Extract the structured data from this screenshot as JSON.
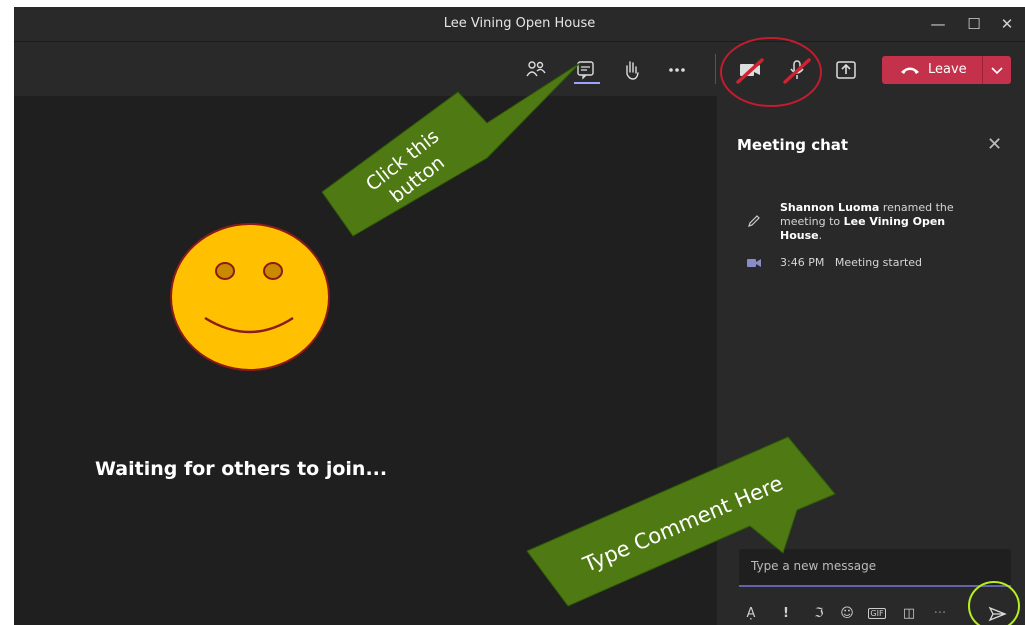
{
  "window": {
    "title": "Lee Vining Open House",
    "minimize_icon": "minimize-icon",
    "maximize_icon": "maximize-icon",
    "close_icon": "close-icon"
  },
  "toolbar": {
    "participants_icon": "people-icon",
    "chat_icon": "chat-icon",
    "raise_hand_icon": "hand-icon",
    "more_icon": "more-icon",
    "camera_icon": "camera-off-icon",
    "mic_icon": "mic-off-icon",
    "share_icon": "share-screen-icon",
    "leave_label": "Leave",
    "leave_color": "#c4314b"
  },
  "stage": {
    "waiting_text": "Waiting for others to join..."
  },
  "chat": {
    "title": "Meeting chat",
    "events": [
      {
        "icon": "pencil-icon",
        "actor": "Shannon Luoma",
        "text1": " renamed the meeting to ",
        "target": "Lee Vining Open House",
        "text2": "."
      },
      {
        "icon": "video-icon",
        "time": "3:46 PM",
        "text": "Meeting started"
      }
    ],
    "compose_placeholder": "Type a new message",
    "compose_tools": [
      "format-icon",
      "important-icon",
      "attach-icon",
      "emoji-icon",
      "gif-icon",
      "sticker-icon",
      "more-icon"
    ],
    "send_icon": "send-icon",
    "accent": "#6264a7"
  },
  "annotations": {
    "click_callout": "Click this button",
    "click_line1": "Click this",
    "click_line2": "button",
    "type_callout": "Type Comment Here",
    "callout_color": "#4f7a13",
    "circle_red": "#c01d2e",
    "circle_green": "#b5f01e"
  }
}
